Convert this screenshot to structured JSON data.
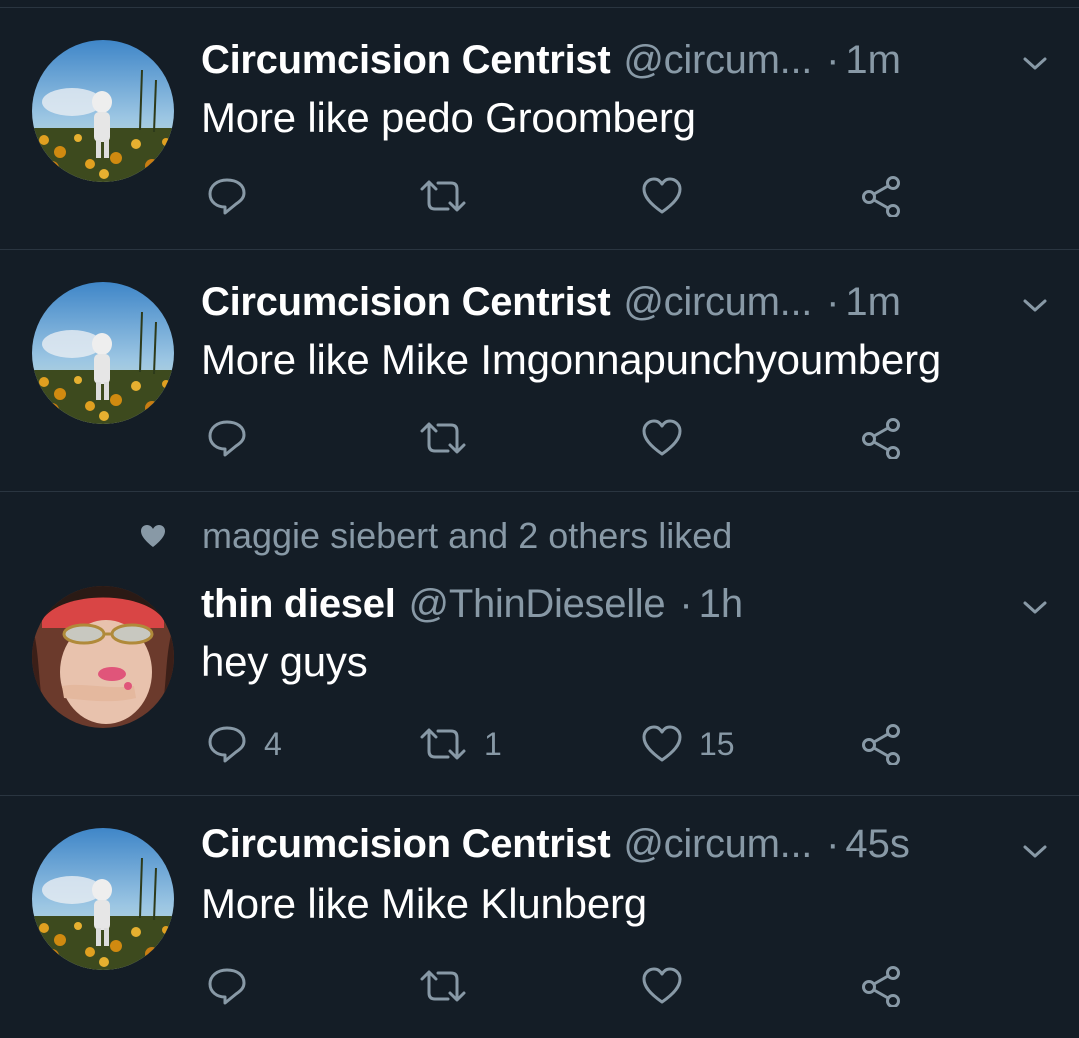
{
  "tweets": [
    {
      "name": "Circumcision Centrist",
      "handle": "@circum...",
      "dot": "·",
      "time": "1m",
      "text": "More like pedo Groomberg",
      "reply_count": "",
      "retweet_count": "",
      "like_count": "",
      "avatar": "astronaut-flower-field"
    },
    {
      "name": "Circumcision Centrist",
      "handle": "@circum...",
      "dot": "·",
      "time": "1m",
      "text": "More like Mike Imgonnapunchyoumberg",
      "reply_count": "",
      "retweet_count": "",
      "like_count": "",
      "avatar": "astronaut-flower-field"
    },
    {
      "social_context": "maggie siebert and 2 others liked",
      "name": "thin diesel",
      "handle": "@ThinDieselle",
      "dot": "·",
      "time": "1h",
      "text": "hey guys",
      "reply_count": "4",
      "retweet_count": "1",
      "like_count": "15",
      "avatar": "woman-with-sunglasses"
    },
    {
      "name": "Circumcision Centrist",
      "handle": "@circum...",
      "dot": "·",
      "time": "45s",
      "text": "More like Mike Klunberg",
      "reply_count": "",
      "retweet_count": "",
      "like_count": "",
      "avatar": "astronaut-flower-field"
    }
  ],
  "colors": {
    "background": "#141d26",
    "divider": "#2a3540",
    "primary_text": "#ffffff",
    "secondary_text": "#8899a6"
  },
  "icons": [
    "reply-icon",
    "retweet-icon",
    "like-icon",
    "share-icon",
    "chevron-down-icon",
    "heart-icon"
  ]
}
